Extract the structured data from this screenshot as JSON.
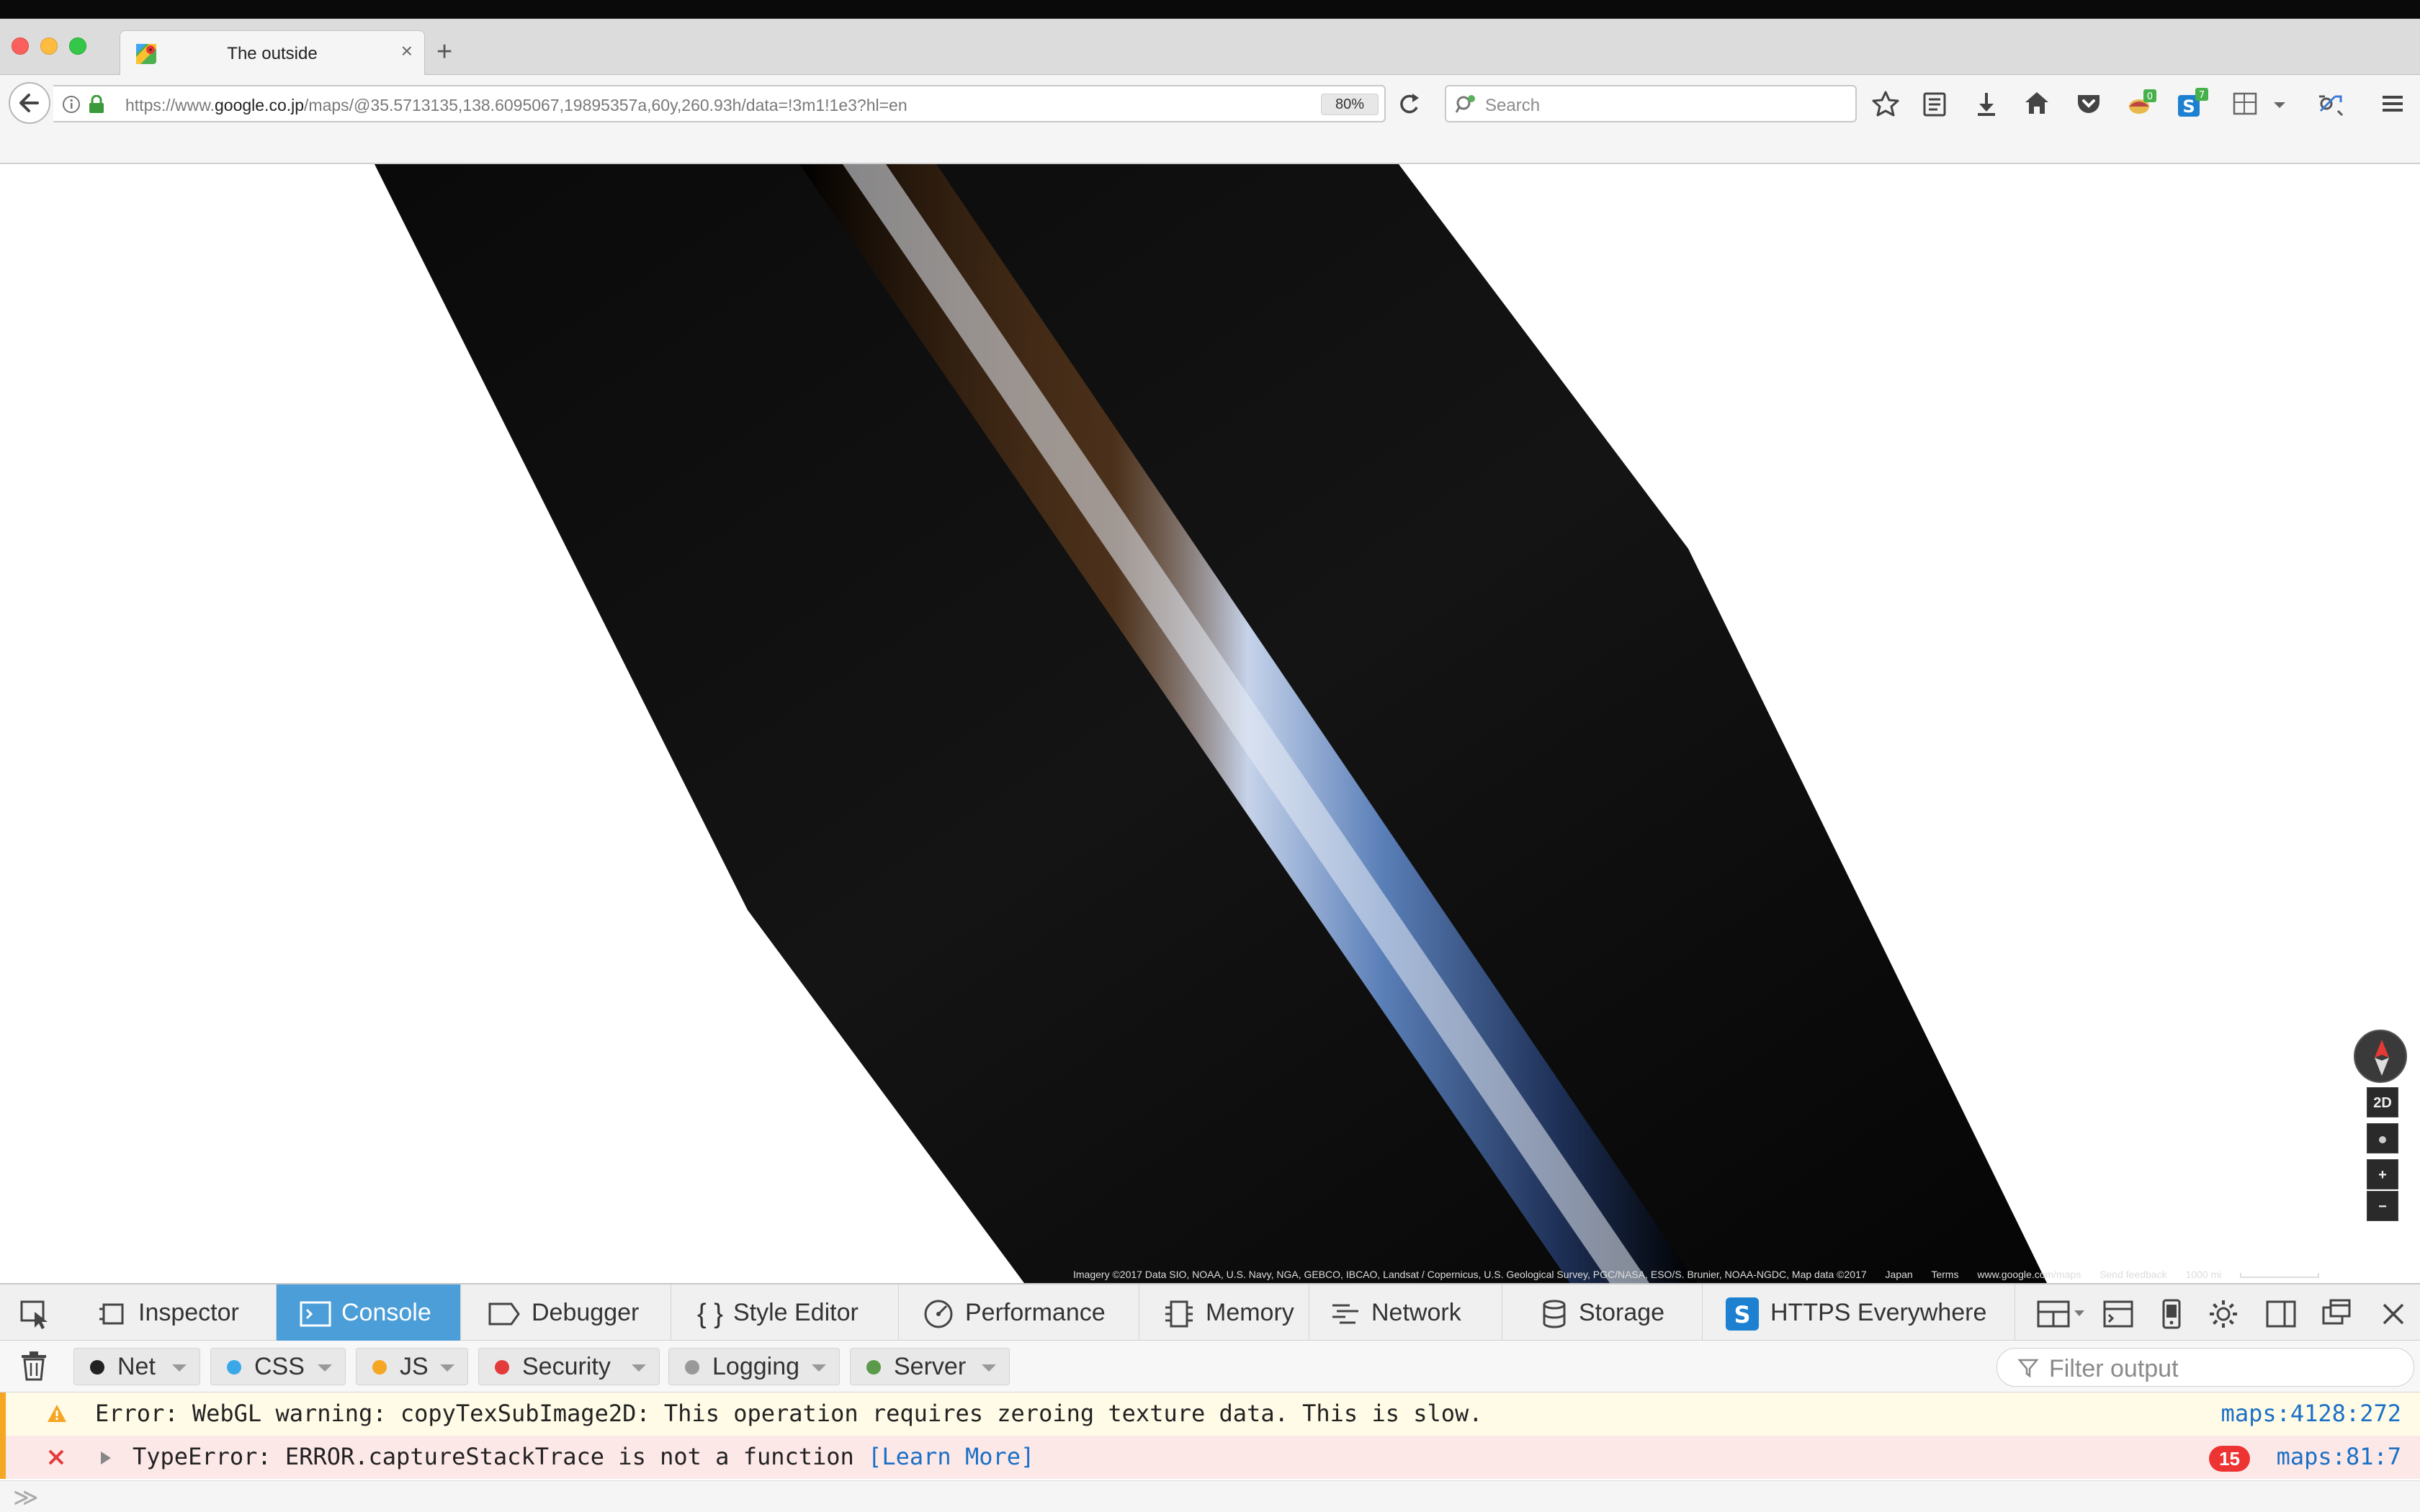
{
  "browser": {
    "tab_title": "The outside",
    "url_prefix": "https://www.",
    "url_domain": "google.co.jp",
    "url_path": "/maps/@35.5713135,138.6095067,19895357a,60y,260.93h/data=!3m1!1e3?hl=en",
    "zoom": "80%",
    "search_placeholder": "Search",
    "badge_count_1": "0",
    "badge_count_2": "7"
  },
  "map": {
    "attribution": "Imagery ©2017 Data SIO, NOAA, U.S. Navy, NGA, GEBCO, IBCAO, Landsat / Copernicus, U.S. Geological Survey, PGC/NASA, ESO/S. Brunier, NOAA-NGDC, Map data ©2017",
    "region": "Japan",
    "terms": "Terms",
    "site": "www.google.com/maps",
    "feedback": "Send feedback",
    "scale": "1000 mi",
    "btn_2d": "2D",
    "btn_zoom_in": "+",
    "btn_zoom_out": "−"
  },
  "devtools": {
    "tabs": [
      "Inspector",
      "Console",
      "Debugger",
      "Style Editor",
      "Performance",
      "Memory",
      "Network",
      "Storage",
      "HTTPS Everywhere"
    ],
    "active_tab": "Console",
    "filters": [
      "Net",
      "CSS",
      "JS",
      "Security",
      "Logging",
      "Server"
    ],
    "filter_colors": [
      "#222222",
      "#3aa8e8",
      "#f5a623",
      "#e33b3b",
      "#999999",
      "#5a9a4a"
    ],
    "filter_placeholder": "Filter output"
  },
  "console": {
    "messages": [
      {
        "level": "warning",
        "text": "Error: WebGL warning: copyTexSubImage2D: This operation requires zeroing texture data. This is slow.",
        "source": "maps:4128:272"
      },
      {
        "level": "error",
        "text": "TypeError: ERROR.captureStackTrace is not a function",
        "link": "[Learn More]",
        "count": "15",
        "source": "maps:81:7"
      }
    ]
  }
}
